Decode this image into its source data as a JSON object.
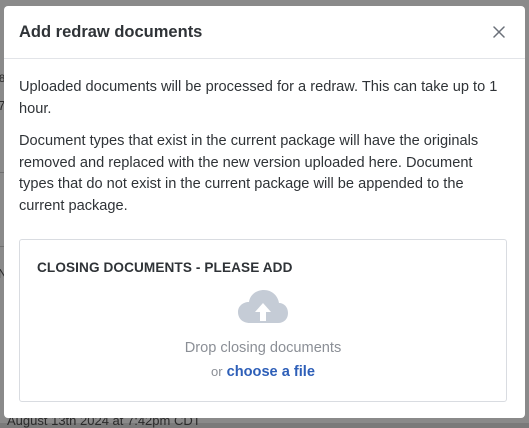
{
  "background": {
    "fragment_top": "8",
    "fragment_mid": "7",
    "fragment_left": "N",
    "footer_timestamp": "August 13th 2024 at 7:42pm CDT"
  },
  "modal": {
    "title": "Add redraw documents",
    "close_icon": "close-icon",
    "paragraph_1": "Uploaded documents will be processed for a redraw. This can take up to 1 hour.",
    "paragraph_2": "Document types that exist in the current package will have the originals removed and replaced with the new version uploaded here. Document types that do not exist in the current package will be appended to the current package."
  },
  "upload": {
    "heading": "CLOSING DOCUMENTS - PLEASE ADD",
    "icon": "cloud-upload-icon",
    "drop_text": "Drop closing documents",
    "or_text": "or",
    "choose_label": "choose a file"
  },
  "colors": {
    "overlay": "#8a8a8a",
    "title_text": "#2f3337",
    "muted_text": "#8b8f96",
    "link": "#2e5fb8",
    "icon": "#c5ccd6"
  }
}
